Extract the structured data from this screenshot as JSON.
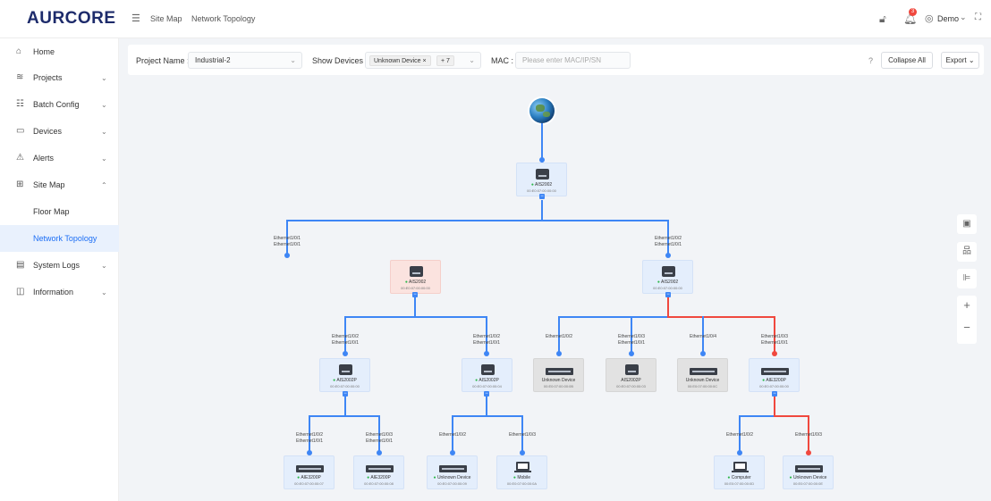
{
  "brand": {
    "logo": "AURCORE"
  },
  "header": {
    "breadcrumb": [
      "Site Map",
      "Network Topology"
    ],
    "notification_count": "3",
    "user": "Demo"
  },
  "sidebar": {
    "items": [
      {
        "label": "Home",
        "icon": "home-icon",
        "chevron": ""
      },
      {
        "label": "Projects",
        "icon": "layers-icon",
        "chevron": "⌄"
      },
      {
        "label": "Batch Config",
        "icon": "sliders-icon",
        "chevron": "⌄"
      },
      {
        "label": "Devices",
        "icon": "monitor-icon",
        "chevron": "⌄"
      },
      {
        "label": "Alerts",
        "icon": "alarm-icon",
        "chevron": "⌄"
      },
      {
        "label": "Site Map",
        "icon": "map-icon",
        "chevron": "⌃"
      },
      {
        "label": "Floor Map",
        "icon": "",
        "chevron": ""
      },
      {
        "label": "Network Topology",
        "icon": "",
        "chevron": ""
      },
      {
        "label": "System Logs",
        "icon": "log-icon",
        "chevron": "⌄"
      },
      {
        "label": "Information",
        "icon": "info-icon",
        "chevron": "⌄"
      }
    ]
  },
  "filters": {
    "project_label": "Project Name :",
    "project_value": "Industrial-2",
    "devices_label": "Show Devices :",
    "device_tag": "Unknown Device",
    "device_more": "+ 7",
    "mac_label": "MAC :",
    "mac_placeholder": "Please enter MAC/IP/SN",
    "help": "?",
    "collapse": "Collapse All",
    "export": "Export"
  },
  "topology": {
    "root": {
      "name": "AIS2002",
      "mac": "00:E0:07:00:00:00"
    },
    "l1": [
      {
        "name": "AIS2002",
        "mac": "00:E0:07:00:00:00",
        "port_parent": "Ethernet1/0/1",
        "port_child": "Ethernet1/0/1"
      },
      {
        "name": "AIS2002",
        "mac": "00:E0:07:00:00:00",
        "port_parent": "Ethernet1/0/2",
        "port_child": "Ethernet1/0/1"
      }
    ],
    "l2": [
      {
        "name": "AIS2002P",
        "mac": "00:E0:07:00:00:00",
        "port_parent": "Ethernet1/0/2",
        "port_child": "Ethernet1/0/1"
      },
      {
        "name": "AIS2002P",
        "mac": "00:E0:07:00:00:04",
        "port_parent": "Ethernet1/0/2",
        "port_child": "Ethernet1/0/1"
      },
      {
        "name": "Unknown Device",
        "mac": "00:E0:07:00:00:0B",
        "port_parent": "Ethernet1/0/2",
        "port_child": ""
      },
      {
        "name": "AIS2002P",
        "mac": "00:E0:07:00:00:03",
        "port_parent": "Ethernet1/0/3",
        "port_child": "Ethernet1/0/1"
      },
      {
        "name": "Unknown Device",
        "mac": "00:E0:07:00:00:0C",
        "port_parent": "Ethernet1/0/4",
        "port_child": ""
      },
      {
        "name": "AIE3200P",
        "mac": "00:E0:07:00:00:00",
        "port_parent": "Ethernet1/0/3",
        "port_child": "Ethernet1/0/1"
      }
    ],
    "l3": [
      {
        "name": "AIE3200P",
        "mac": "00:E0:07:00:00:07",
        "port_parent": "Ethernet1/0/2",
        "port_child": "Ethernet1/0/1"
      },
      {
        "name": "AIE3200P",
        "mac": "00:E0:07:00:00:08",
        "port_parent": "Ethernet1/0/3",
        "port_child": "Ethernet1/0/1"
      },
      {
        "name": "Unknown Device",
        "mac": "00:E0:07:00:00:09",
        "port_parent": "Ethernet1/0/2",
        "port_child": ""
      },
      {
        "name": "Mobile",
        "mac": "00:E0:07:00:00:0A",
        "port_parent": "Ethernet1/0/3",
        "port_child": ""
      },
      {
        "name": "Computer",
        "mac": "00:E0:07:00:00:0D",
        "port_parent": "Ethernet1/0/2",
        "port_child": ""
      },
      {
        "name": "Unknown Device",
        "mac": "00:E0:07:00:00:0E",
        "port_parent": "Ethernet1/0/3",
        "port_child": ""
      }
    ]
  },
  "colors": {
    "link": "#3e86f5",
    "alert_link": "#f0483e",
    "accent": "#1d6ff5"
  }
}
